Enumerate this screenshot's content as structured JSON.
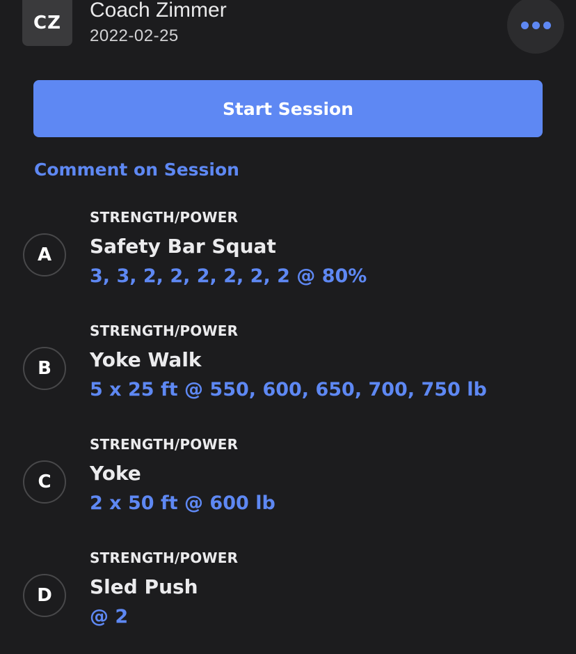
{
  "header": {
    "avatar_initials": "CZ",
    "coach_name": "Coach Zimmer",
    "date": "2022-02-25",
    "more_icon": "ellipsis-icon"
  },
  "actions": {
    "start_label": "Start Session",
    "comment_label": "Comment on Session"
  },
  "colors": {
    "background": "#1c1c1e",
    "accent": "#5e88f3",
    "avatar_bg": "#3a3a3c",
    "more_button_bg": "#2c2c2e"
  },
  "exercises": [
    {
      "letter": "A",
      "category": "STRENGTH/POWER",
      "name": "Safety Bar Squat",
      "prescription": "3, 3, 2, 2, 2, 2, 2, 2 @ 80%"
    },
    {
      "letter": "B",
      "category": "STRENGTH/POWER",
      "name": "Yoke Walk",
      "prescription": "5 x 25 ft @ 550, 600, 650, 700, 750 lb"
    },
    {
      "letter": "C",
      "category": "STRENGTH/POWER",
      "name": "Yoke",
      "prescription": "2 x 50 ft @ 600 lb"
    },
    {
      "letter": "D",
      "category": "STRENGTH/POWER",
      "name": "Sled Push",
      "prescription": "@ 2"
    }
  ]
}
